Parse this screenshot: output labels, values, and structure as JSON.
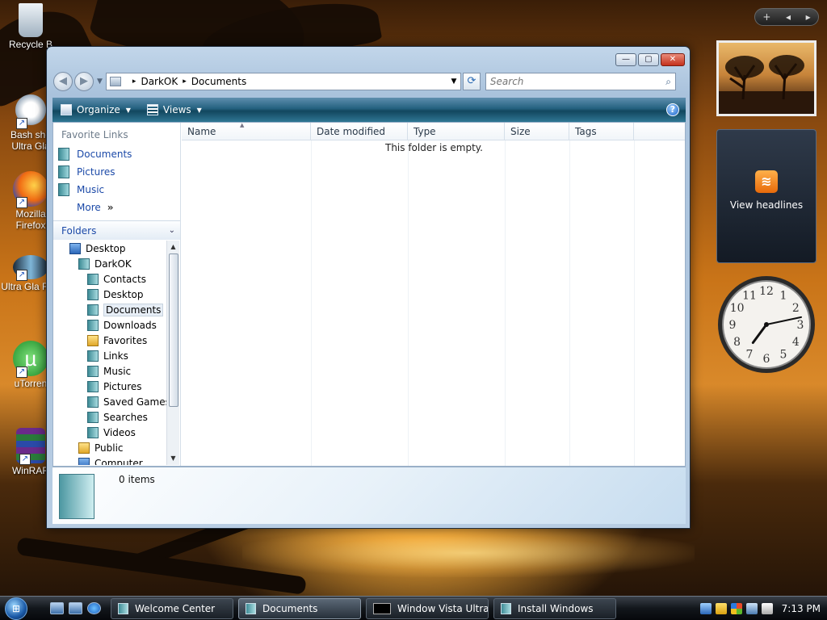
{
  "desktop": {
    "icons": [
      {
        "label": "Recycle B"
      },
      {
        "label": "Bash she Ultra Gla"
      },
      {
        "label": "Mozilla Firefox"
      },
      {
        "label": "Ultra Gla Fish"
      },
      {
        "label": "uTorren"
      },
      {
        "label": "WinRAR"
      }
    ]
  },
  "sidebar": {
    "control_add": "+",
    "control_prev": "◂",
    "control_next": "▸",
    "feed_label": "View headlines",
    "rss_glyph": "≋",
    "clock": {
      "hour": 7,
      "minute": 13,
      "numerals": [
        "12",
        "1",
        "2",
        "3",
        "4",
        "5",
        "6",
        "7",
        "8",
        "9",
        "10",
        "11"
      ]
    }
  },
  "window": {
    "buttons": {
      "minimize": "—",
      "maximize": "▢",
      "close": "✕"
    },
    "nav": {
      "back": "◀",
      "forward": "▶",
      "dropdown": "▼",
      "refresh": "⟳"
    },
    "address": {
      "segments": [
        "DarkOK",
        "Documents"
      ],
      "separator": "▸",
      "dropdown": "▼"
    },
    "search": {
      "placeholder": "Search",
      "icon": "⌕"
    },
    "toolbar": {
      "organize": "Organize",
      "views": "Views",
      "caret": "▼",
      "help": "?"
    },
    "nav_pane": {
      "favorites_heading": "Favorite Links",
      "favorites": [
        "Documents",
        "Pictures",
        "Music"
      ],
      "more": "More",
      "more_arrow": "»",
      "folders_heading": "Folders",
      "folders_chevron": "⌄",
      "tree": [
        {
          "label": "Desktop",
          "indent": 0,
          "icon": "blue"
        },
        {
          "label": "DarkOK",
          "indent": 1,
          "icon": "teal"
        },
        {
          "label": "Contacts",
          "indent": 2,
          "icon": "teal"
        },
        {
          "label": "Desktop",
          "indent": 2,
          "icon": "teal"
        },
        {
          "label": "Documents",
          "indent": 2,
          "icon": "teal",
          "selected": true
        },
        {
          "label": "Downloads",
          "indent": 2,
          "icon": "teal"
        },
        {
          "label": "Favorites",
          "indent": 2,
          "icon": "yellow"
        },
        {
          "label": "Links",
          "indent": 2,
          "icon": "teal"
        },
        {
          "label": "Music",
          "indent": 2,
          "icon": "teal"
        },
        {
          "label": "Pictures",
          "indent": 2,
          "icon": "teal"
        },
        {
          "label": "Saved Games",
          "indent": 2,
          "icon": "teal"
        },
        {
          "label": "Searches",
          "indent": 2,
          "icon": "teal"
        },
        {
          "label": "Videos",
          "indent": 2,
          "icon": "teal"
        },
        {
          "label": "Public",
          "indent": 1,
          "icon": "yellow"
        },
        {
          "label": "Computer",
          "indent": 1,
          "icon": "blue"
        }
      ],
      "scroll_up": "▲",
      "scroll_down": "▼"
    },
    "columns": [
      "Name",
      "Date modified",
      "Type",
      "Size",
      "Tags"
    ],
    "sort_indicator": "▲",
    "empty_message": "This folder is empty.",
    "details": {
      "count": "0 items"
    }
  },
  "taskbar": {
    "start_glyph": "⊞",
    "tasks": [
      {
        "label": "Welcome Center",
        "icon": "folder"
      },
      {
        "label": "Documents",
        "icon": "folder",
        "active": true
      },
      {
        "label": "Window Vista Ultra ...",
        "icon": "cmd"
      },
      {
        "label": "Install Windows",
        "icon": "folder"
      }
    ],
    "time": "7:13 PM"
  }
}
